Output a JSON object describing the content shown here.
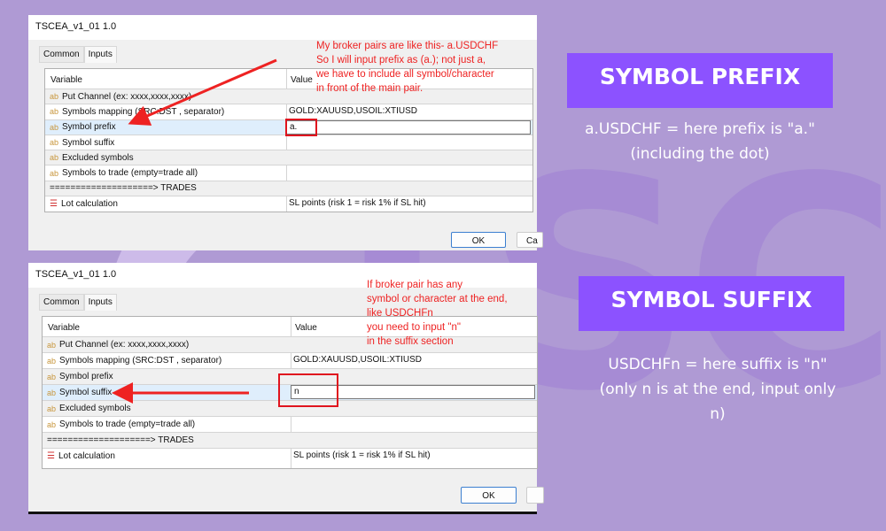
{
  "colors": {
    "background": "#af9ad4",
    "tag": "#8c52ff",
    "annotation": "#ee2222"
  },
  "watermark": "TSC",
  "dialogs": [
    {
      "title": "TSCEA_v1_01 1.0",
      "tabs": [
        "Common",
        "Inputs"
      ],
      "active_tab": "Inputs",
      "headers": [
        "Variable",
        "Value"
      ],
      "rows": [
        {
          "icon": "ab",
          "name": "Put Channel (ex: xxxx,xxxx,xxxx)",
          "value": ""
        },
        {
          "icon": "ab",
          "name": "Symbols mapping (SRC:DST , separator)",
          "value": "GOLD:XAUUSD,USOIL:XTIUSD"
        },
        {
          "icon": "ab",
          "name": "Symbol prefix",
          "value": "a."
        },
        {
          "icon": "ab",
          "name": "Symbol suffix",
          "value": ""
        },
        {
          "icon": "ab",
          "name": "Excluded symbols",
          "value": ""
        },
        {
          "icon": "ab",
          "name": "Symbols to trade (empty=trade all)",
          "value": ""
        },
        {
          "icon": "",
          "name": "====================> TRADES",
          "value": ""
        },
        {
          "icon": "list",
          "name": "Lot calculation",
          "value": "SL points (risk 1 = risk 1% if SL hit)"
        }
      ],
      "ok": "OK",
      "cancel": "Ca",
      "annotation": [
        "My broker pairs are like this-  a.USDCHF",
        "So I will input prefix as (a.); not just a,",
        "we have to include all symbol/character",
        "in front of the main pair."
      ]
    },
    {
      "title": "TSCEA_v1_01 1.0",
      "tabs": [
        "Common",
        "Inputs"
      ],
      "active_tab": "Inputs",
      "headers": [
        "Variable",
        "Value"
      ],
      "rows": [
        {
          "icon": "ab",
          "name": "Put Channel (ex: xxxx,xxxx,xxxx)",
          "value": ""
        },
        {
          "icon": "ab",
          "name": "Symbols mapping (SRC:DST , separator)",
          "value": "GOLD:XAUUSD,USOIL:XTIUSD"
        },
        {
          "icon": "ab",
          "name": "Symbol prefix",
          "value": ""
        },
        {
          "icon": "ab",
          "name": "Symbol suffix",
          "value": "n"
        },
        {
          "icon": "ab",
          "name": "Excluded symbols",
          "value": ""
        },
        {
          "icon": "ab",
          "name": "Symbols to trade (empty=trade all)",
          "value": ""
        },
        {
          "icon": "",
          "name": "====================> TRADES",
          "value": ""
        },
        {
          "icon": "list",
          "name": "Lot calculation",
          "value": "SL points (risk 1 = risk 1% if SL hit)"
        }
      ],
      "ok": "OK",
      "annotation": [
        "If broker pair has any",
        "symbol or character at the end,",
        "like USDCHFn",
        "you need to input \"n\"",
        "in the suffix section"
      ]
    }
  ],
  "prefix": {
    "tag": "SYMBOL PREFIX",
    "desc": [
      "a.USDCHF = here prefix is \"a.\"",
      "(including the dot)"
    ]
  },
  "suffix": {
    "tag": "SYMBOL SUFFIX",
    "desc": [
      "USDCHFn = here suffix is \"n\"",
      "(only n is at the end, input only",
      "n)"
    ]
  }
}
